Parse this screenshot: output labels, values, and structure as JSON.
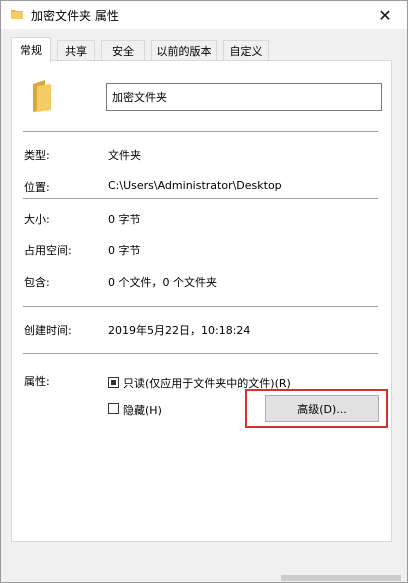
{
  "window": {
    "title": "加密文件夹 属性",
    "close_glyph": "✕"
  },
  "tabs": [
    {
      "label": "常规",
      "active": true
    },
    {
      "label": "共享",
      "active": false
    },
    {
      "label": "安全",
      "active": false
    },
    {
      "label": "以前的版本",
      "active": false
    },
    {
      "label": "自定义",
      "active": false
    }
  ],
  "general": {
    "folder_name": "加密文件夹",
    "rows": [
      {
        "label": "类型:",
        "value": "文件夹"
      },
      {
        "label": "位置:",
        "value": "C:\\Users\\Administrator\\Desktop"
      },
      {
        "label": "大小:",
        "value": "0 字节"
      },
      {
        "label": "占用空间:",
        "value": "0 字节"
      },
      {
        "label": "包含:",
        "value": "0 个文件，0 个文件夹"
      }
    ],
    "created_label": "创建时间:",
    "created_value": "2019年5月22日，10:18:24",
    "attributes_label": "属性:",
    "readonly_label": "只读(仅应用于文件夹中的文件)(R)",
    "hidden_label": "隐藏(H)",
    "advanced_button": "高级(D)..."
  },
  "colors": {
    "highlight": "#d0332c",
    "folder": "#e8b84a"
  },
  "icons": {
    "title_icon": "folder-icon",
    "big_icon": "folder-icon",
    "close": "close-icon"
  }
}
